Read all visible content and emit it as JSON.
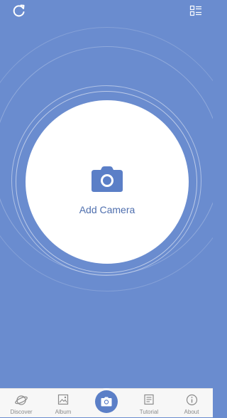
{
  "header": {
    "refresh_icon": "refresh-icon",
    "list_icon": "list-view-icon"
  },
  "main": {
    "add_camera_label": "Add Camera",
    "add_camera_icon": "camera-icon"
  },
  "tabbar": {
    "items": [
      {
        "label": "Discover",
        "icon": "planet-icon"
      },
      {
        "label": "Album",
        "icon": "image-icon"
      },
      {
        "label": "",
        "icon": "camera-icon",
        "active": true
      },
      {
        "label": "Tutorial",
        "icon": "document-icon"
      },
      {
        "label": "About",
        "icon": "info-icon"
      }
    ]
  },
  "colors": {
    "background": "#6a8ccf",
    "accent": "#5b7fc7",
    "camera_icon": "#5b7fc7",
    "label": "#4f6fae",
    "tab_label": "#8a8a8a"
  }
}
